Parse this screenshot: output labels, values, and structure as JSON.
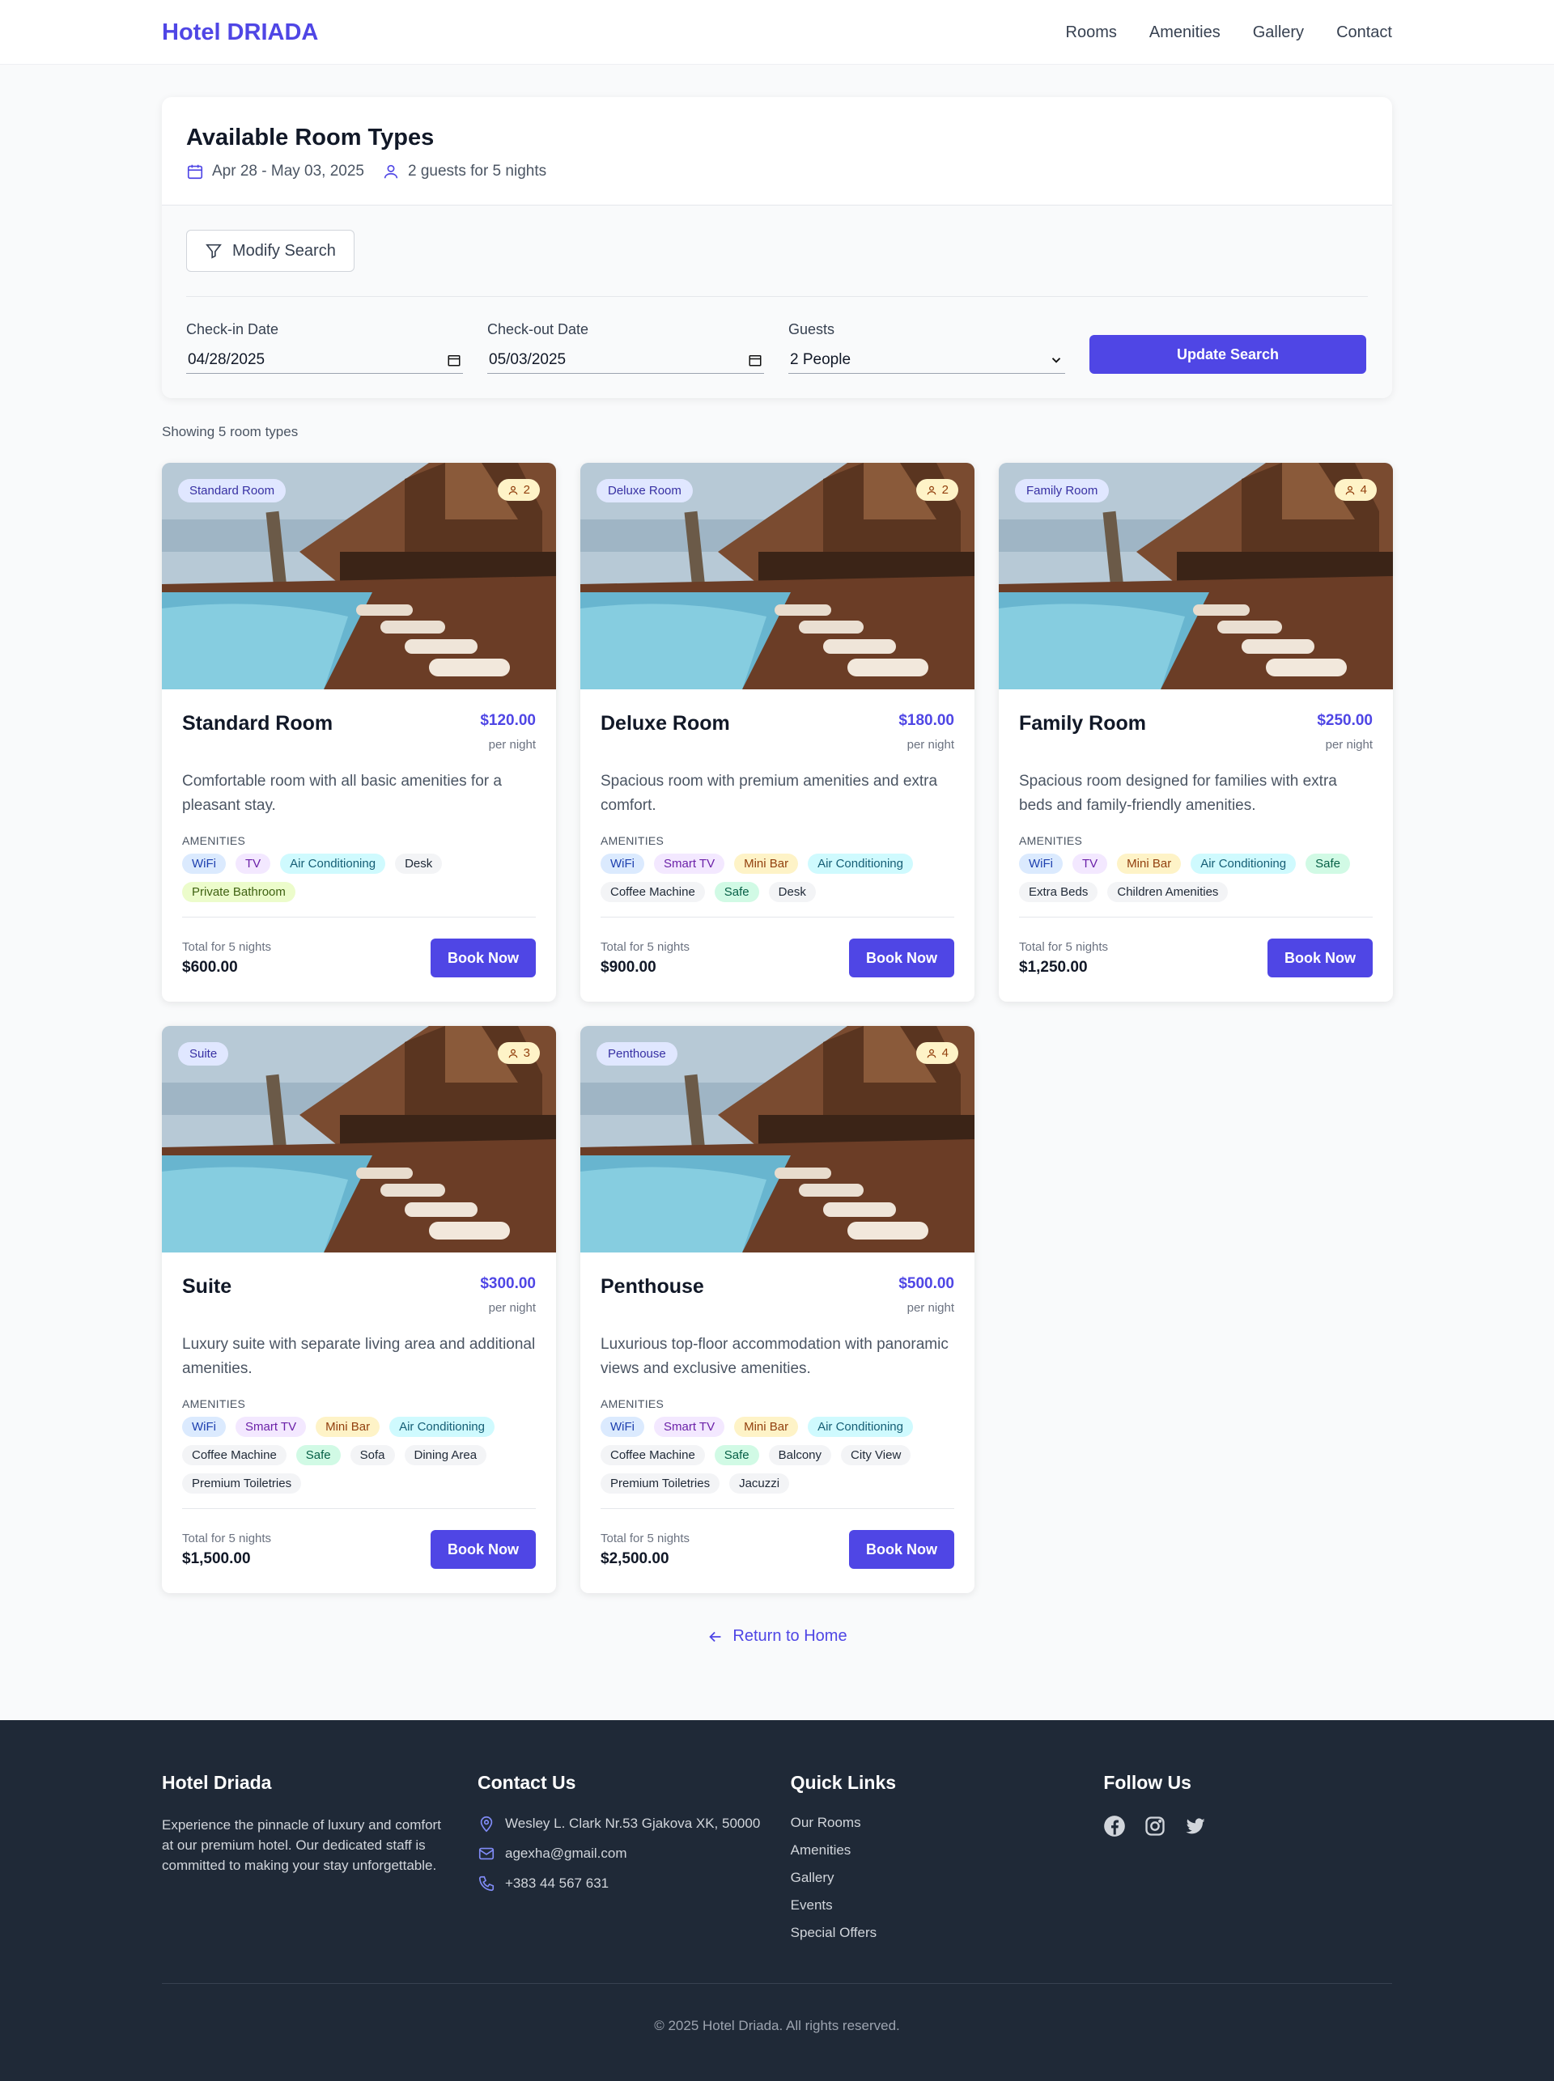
{
  "header": {
    "brand": "Hotel DRIADA",
    "nav": [
      "Rooms",
      "Amenities",
      "Gallery",
      "Contact"
    ]
  },
  "search": {
    "title": "Available Room Types",
    "dates": "Apr 28 - May 03, 2025",
    "guests_summary": "2 guests for 5 nights",
    "modify_label": "Modify Search",
    "checkin_label": "Check-in Date",
    "checkin_value": "04/28/2025",
    "checkout_label": "Check-out Date",
    "checkout_value": "05/03/2025",
    "guests_label": "Guests",
    "guests_value": "2 People",
    "update_label": "Update Search"
  },
  "showing": "Showing 5 room types",
  "amenities_label": "AMENITIES",
  "per_night": "per night",
  "book_label": "Book Now",
  "rooms": [
    {
      "badge": "Standard Room",
      "capacity": "2",
      "name": "Standard Room",
      "price": "$120.00",
      "desc": "Comfortable room with all basic amenities for a pleasant stay.",
      "amenities": [
        "WiFi",
        "TV",
        "Air Conditioning",
        "Desk",
        "Private Bathroom"
      ],
      "total_label": "Total for 5 nights",
      "total": "$600.00"
    },
    {
      "badge": "Deluxe Room",
      "capacity": "2",
      "name": "Deluxe Room",
      "price": "$180.00",
      "desc": "Spacious room with premium amenities and extra comfort.",
      "amenities": [
        "WiFi",
        "Smart TV",
        "Mini Bar",
        "Air Conditioning",
        "Coffee Machine",
        "Safe",
        "Desk"
      ],
      "total_label": "Total for 5 nights",
      "total": "$900.00"
    },
    {
      "badge": "Family Room",
      "capacity": "4",
      "name": "Family Room",
      "price": "$250.00",
      "desc": "Spacious room designed for families with extra beds and family-friendly amenities.",
      "amenities": [
        "WiFi",
        "TV",
        "Mini Bar",
        "Air Conditioning",
        "Safe",
        "Extra Beds",
        "Children Amenities"
      ],
      "total_label": "Total for 5 nights",
      "total": "$1,250.00"
    },
    {
      "badge": "Suite",
      "capacity": "3",
      "name": "Suite",
      "price": "$300.00",
      "desc": "Luxury suite with separate living area and additional amenities.",
      "amenities": [
        "WiFi",
        "Smart TV",
        "Mini Bar",
        "Air Conditioning",
        "Coffee Machine",
        "Safe",
        "Sofa",
        "Dining Area",
        "Premium Toiletries"
      ],
      "total_label": "Total for 5 nights",
      "total": "$1,500.00"
    },
    {
      "badge": "Penthouse",
      "capacity": "4",
      "name": "Penthouse",
      "price": "$500.00",
      "desc": "Luxurious top-floor accommodation with panoramic views and exclusive amenities.",
      "amenities": [
        "WiFi",
        "Smart TV",
        "Mini Bar",
        "Air Conditioning",
        "Coffee Machine",
        "Safe",
        "Balcony",
        "City View",
        "Premium Toiletries",
        "Jacuzzi"
      ],
      "total_label": "Total for 5 nights",
      "total": "$2,500.00"
    }
  ],
  "tag_colors": {
    "WiFi": [
      "#dbeafe",
      "#1e40af"
    ],
    "TV": [
      "#f3e8ff",
      "#6b21a8"
    ],
    "Smart TV": [
      "#f3e8ff",
      "#6b21a8"
    ],
    "Mini Bar": [
      "#fef3c7",
      "#92400e"
    ],
    "Air Conditioning": [
      "#cffafe",
      "#155e75"
    ],
    "Safe": [
      "#d1fae5",
      "#065f46"
    ],
    "Private Bathroom": [
      "#ecfccb",
      "#3f6212"
    ],
    "default": [
      "#f3f4f6",
      "#1f2937"
    ]
  },
  "return_label": "Return to Home",
  "footer": {
    "about_title": "Hotel Driada",
    "about_text": "Experience the pinnacle of luxury and comfort at our premium hotel. Our dedicated staff is committed to making your stay unforgettable.",
    "contact_title": "Contact Us",
    "address": "Wesley L. Clark Nr.53 Gjakova XK, 50000",
    "email": "agexha@gmail.com",
    "phone": "+383 44 567 631",
    "links_title": "Quick Links",
    "links": [
      "Our Rooms",
      "Amenities",
      "Gallery",
      "Events",
      "Special Offers"
    ],
    "follow_title": "Follow Us",
    "social_icons": [
      "facebook-icon",
      "instagram-icon",
      "twitter-icon"
    ],
    "copyright": "© 2025 Hotel Driada. All rights reserved."
  }
}
